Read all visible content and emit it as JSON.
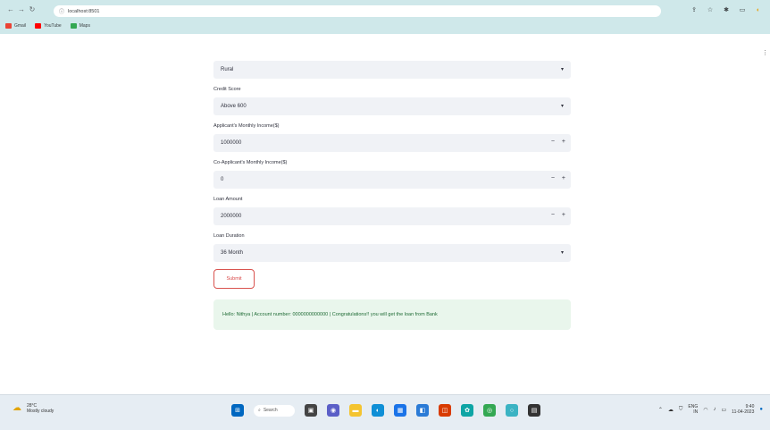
{
  "browser": {
    "url": "localhost:8501",
    "bookmarks": [
      {
        "label": "Gmail",
        "color": "#ea4335"
      },
      {
        "label": "YouTube",
        "color": "#ff0000"
      },
      {
        "label": "Maps",
        "color": "#34a853"
      }
    ]
  },
  "form": {
    "fields": [
      {
        "label": "",
        "type": "select",
        "value": "Rural"
      },
      {
        "label": "Credit Score",
        "type": "select",
        "value": "Above 600"
      },
      {
        "label": "Applicant's Monthly Income($)",
        "type": "number",
        "value": "1000000"
      },
      {
        "label": "Co-Applicant's Monthly Income($)",
        "type": "number",
        "value": "0"
      },
      {
        "label": "Loan Amount",
        "type": "number",
        "value": "2000000"
      },
      {
        "label": "Loan Duration",
        "type": "select",
        "value": "36 Month"
      }
    ],
    "submit_label": "Submit",
    "success_message": "Hello: Nithya | Account number: 0000000000000 | Congratulations!! you will get the loan from Bank"
  },
  "taskbar": {
    "weather_temp": "28°C",
    "weather_desc": "Mostly cloudy",
    "search_label": "Search",
    "language": "ENG",
    "region": "IN",
    "time": "9:40",
    "date": "11-04-2023"
  },
  "colors": {
    "chrome_bg": "#cfe8ea",
    "input_bg": "#f0f2f6",
    "success_bg": "#e9f6ec",
    "submit_border": "#d9534f"
  }
}
